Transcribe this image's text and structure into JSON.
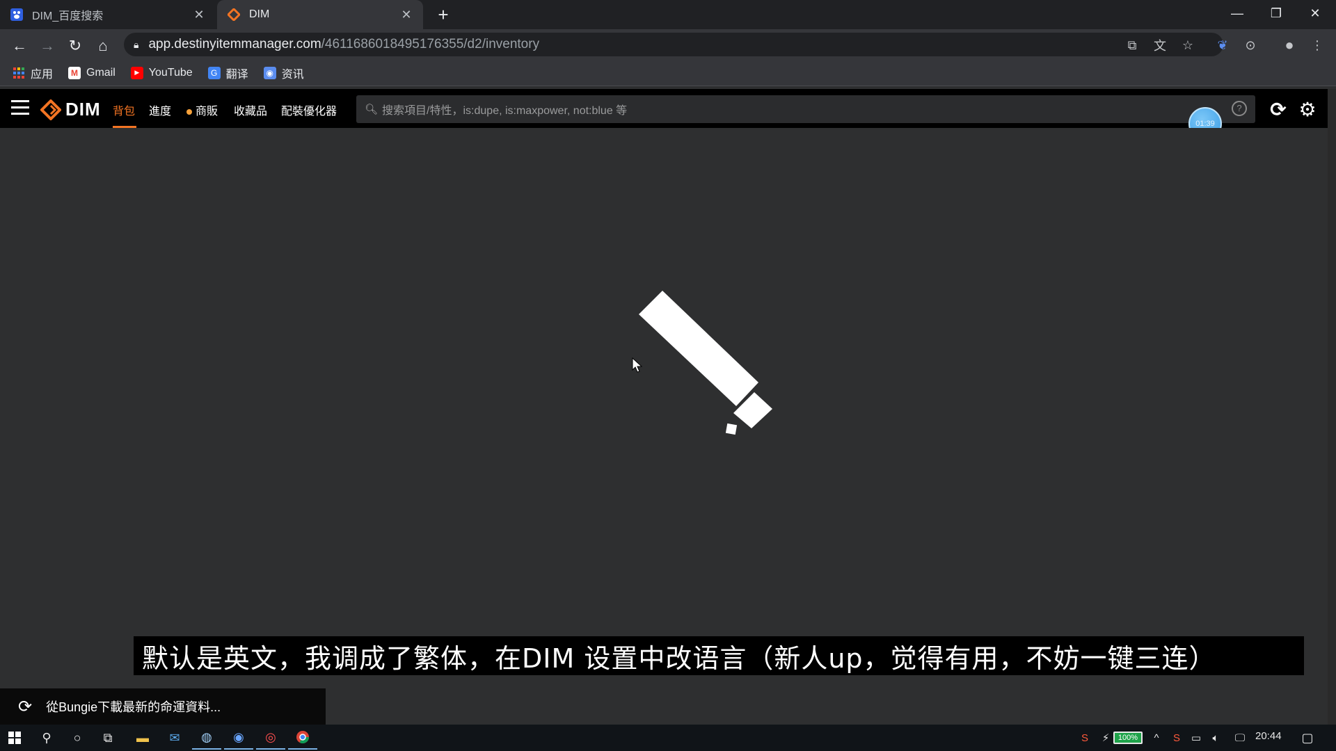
{
  "browser": {
    "tabs": [
      {
        "title": "DIM_百度搜索",
        "icon": "baidu-icon",
        "active": false
      },
      {
        "title": "DIM",
        "icon": "dim-icon",
        "active": true
      }
    ],
    "new_tab": "+",
    "window_controls": {
      "minimize": "—",
      "restore": "❐",
      "close": "✕"
    },
    "url_host": "app.destinyitemmanager.com",
    "url_path": "/4611686018495176355/d2/inventory",
    "bookmarks": [
      {
        "label": "应用",
        "icon": "apps-grid-icon"
      },
      {
        "label": "Gmail",
        "icon": "gmail-icon"
      },
      {
        "label": "YouTube",
        "icon": "youtube-icon"
      },
      {
        "label": "翻译",
        "icon": "translate-icon"
      },
      {
        "label": "资讯",
        "icon": "news-icon"
      }
    ]
  },
  "dim": {
    "logo_text": "DIM",
    "nav": [
      {
        "label": "背包",
        "active": true
      },
      {
        "label": "進度"
      },
      {
        "label": "商販",
        "dot": true
      },
      {
        "label": "收藏品"
      },
      {
        "label": "配裝優化器"
      }
    ],
    "search_placeholder": "搜索項目/特性，is:dupe, is:maxpower, not:blue 等",
    "help": "?",
    "timer": "01:39",
    "accent": "#f37423"
  },
  "subtitle": "默认是英文，我调成了繁体，在DIM 设置中改语言（新人up，觉得有用，不妨一键三连）",
  "toast": "從Bungie下載最新的命運資料...",
  "taskbar": {
    "battery": "100%",
    "time": "20:44"
  }
}
